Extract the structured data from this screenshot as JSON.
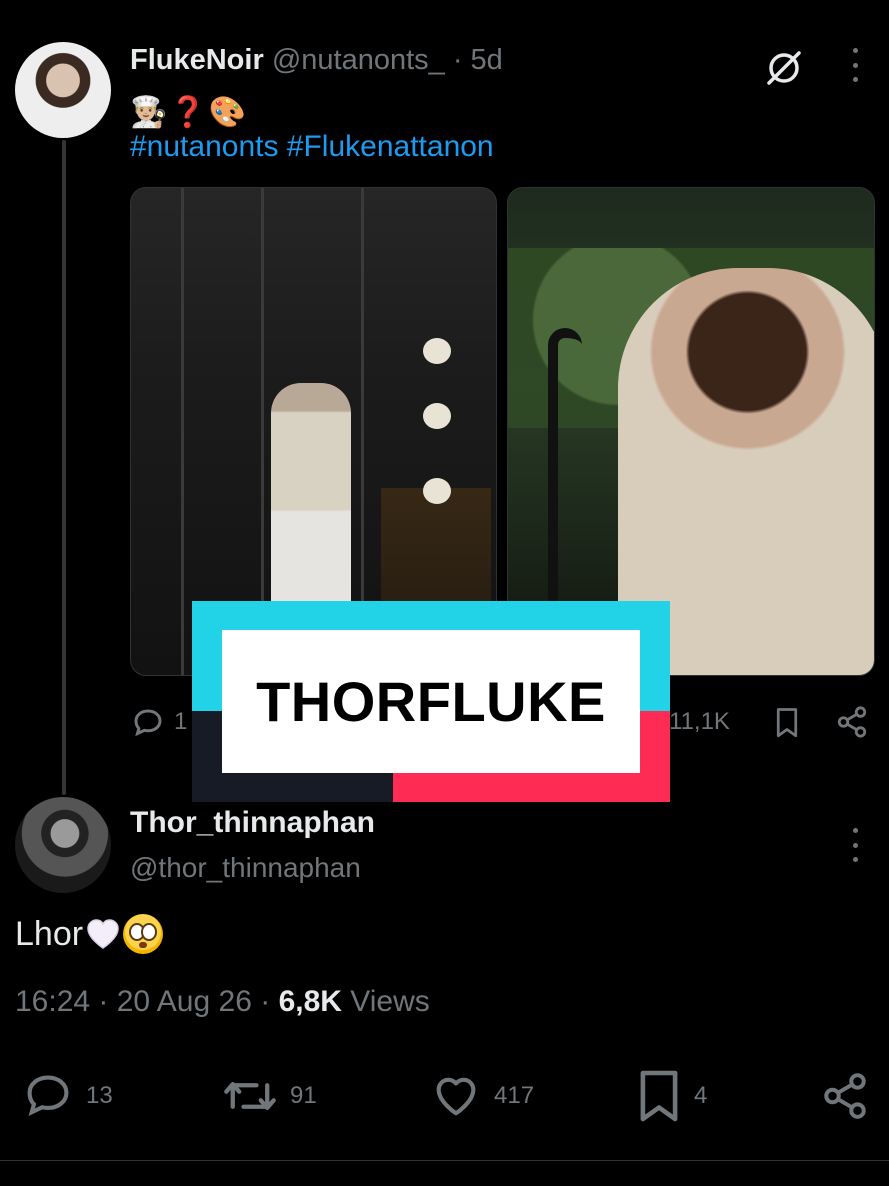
{
  "post": {
    "display_name": "FlukeNoir",
    "handle_meta": "@nutanonts_ · 5d",
    "emojis": [
      "👨🏼‍🍳",
      "❓",
      "🎨"
    ],
    "hashtags": "#nutanonts #Flukenattanon",
    "photos": [
      "photo-1",
      "photo-2"
    ],
    "reply_count_partial": "1",
    "views_partial": "11,1K"
  },
  "overlay": {
    "label": "THORFLUKE",
    "colors": {
      "cyan": "#22d3e8",
      "pink": "#fe2c55",
      "dark": "#171b26"
    }
  },
  "reply": {
    "display_name": "Thor_thinnaphan",
    "handle": "@thor_thinnaphan",
    "text": "Lhor",
    "emojis": [
      "white-heart",
      "flushed-face"
    ],
    "time": "16:24",
    "sep1": " · ",
    "date": "20 Aug 26",
    "sep2": " · ",
    "views_count": "6,8K",
    "views_label": " Views"
  },
  "actions": {
    "replies": "13",
    "retweets": "91",
    "likes": "417",
    "bookmarks": "4"
  },
  "icons": {
    "grok": "grok-slash-icon",
    "more": "more-dots-icon",
    "reply": "reply-bubble-icon",
    "retweet": "retweet-icon",
    "like": "heart-icon",
    "bookmark": "bookmark-icon",
    "share": "share-icon"
  },
  "colors": {
    "background": "#000000",
    "text_primary": "#e7e9ea",
    "text_secondary": "#71767b",
    "link": "#1d9bf0",
    "thread_line": "#333639"
  }
}
